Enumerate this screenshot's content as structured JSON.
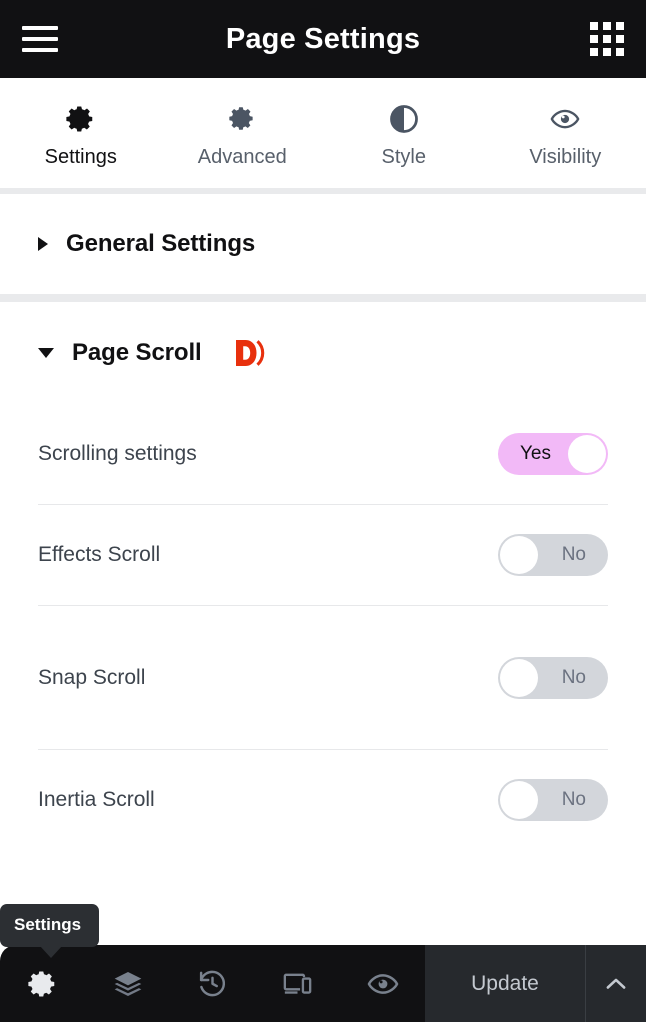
{
  "header": {
    "title": "Page Settings",
    "menu_icon": "hamburger-menu-icon",
    "apps_icon": "grid-apps-icon"
  },
  "tabs": [
    {
      "label": "Settings",
      "icon": "gear-icon",
      "active": true
    },
    {
      "label": "Advanced",
      "icon": "gear-icon",
      "active": false
    },
    {
      "label": "Style",
      "icon": "contrast-icon",
      "active": false
    },
    {
      "label": "Visibility",
      "icon": "eye-icon",
      "active": false
    }
  ],
  "sections": [
    {
      "title": "General Settings",
      "expanded": false,
      "caret": "caret-right-icon"
    },
    {
      "title": "Page Scroll",
      "expanded": true,
      "caret": "caret-down-icon",
      "badge": "dynamic-d-logo",
      "badge_color": "#e8300d",
      "rows": [
        {
          "label": "Scrolling settings",
          "value": "Yes",
          "state": "on"
        },
        {
          "label": "Effects Scroll",
          "value": "No",
          "state": "off"
        },
        {
          "label": "Snap Scroll",
          "value": "No",
          "state": "off"
        },
        {
          "label": "Inertia Scroll",
          "value": "No",
          "state": "off"
        }
      ]
    }
  ],
  "tooltip": {
    "text": "Settings"
  },
  "bottombar": {
    "icons": [
      {
        "name": "gear-icon",
        "active": true
      },
      {
        "name": "layers-icon",
        "active": false
      },
      {
        "name": "history-icon",
        "active": false
      },
      {
        "name": "responsive-icon",
        "active": false
      },
      {
        "name": "eye-icon",
        "active": false
      }
    ],
    "update_label": "Update",
    "collapse_icon": "chevron-up-icon"
  },
  "colors": {
    "header_bg": "#111113",
    "toggle_on": "#f2b9f7",
    "toggle_off": "#d3d6db",
    "accent_logo": "#e8300d",
    "active_tab": "#111113"
  }
}
